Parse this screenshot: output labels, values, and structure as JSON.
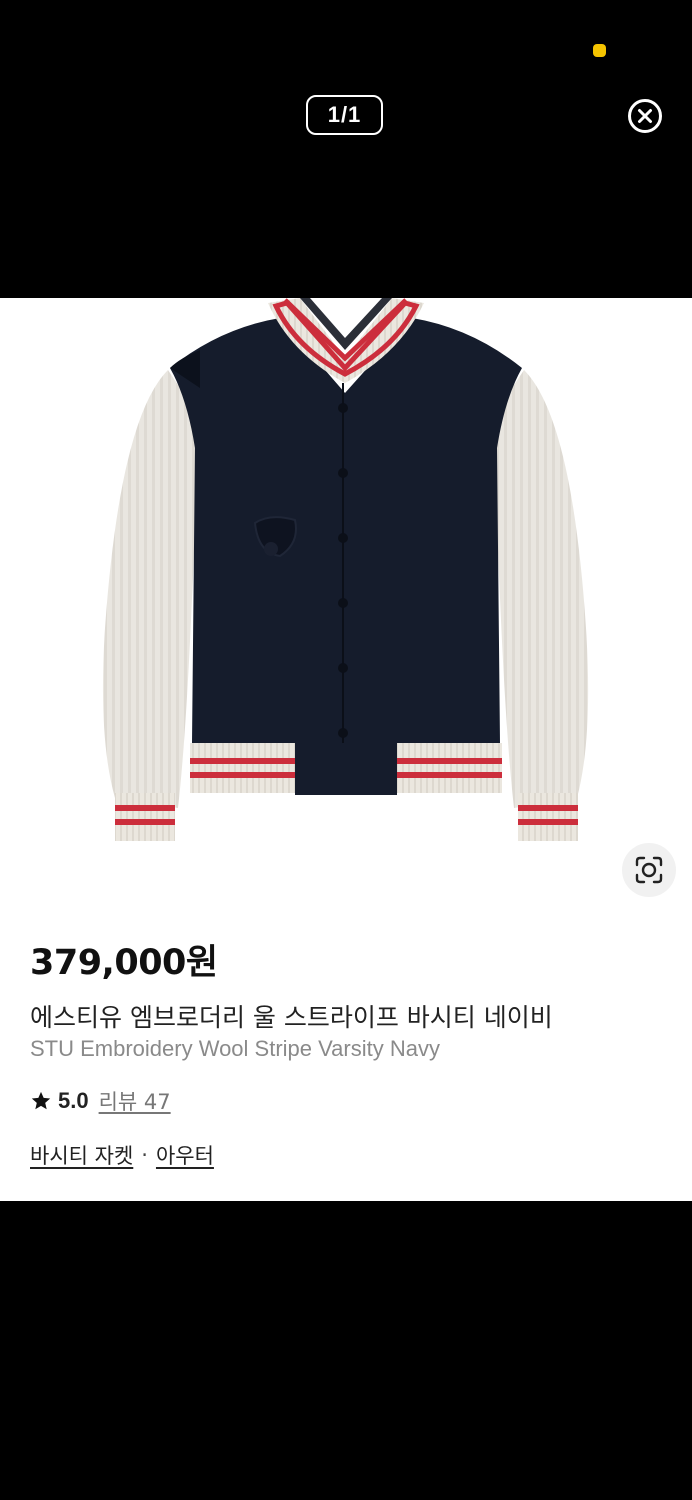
{
  "viewer": {
    "counter": "1/1",
    "close_icon": "close-circle-icon"
  },
  "product": {
    "price": "379,000원",
    "name_ko": "에스티유 엠브로더리 울 스트라이프 바시티 네이비",
    "name_en": "STU Embroidery Wool Stripe Varsity Navy",
    "rating": "5.0",
    "review_label": "리뷰 47",
    "categories": [
      "바시티 자켓",
      "아우터"
    ],
    "category_separator": "·"
  },
  "colors": {
    "navy": "#151c2c",
    "cream": "#ebe7df",
    "stripe_red": "#cc2e3c",
    "status_dot": "#f5c400"
  },
  "icons": {
    "rating": "star-icon",
    "image_search": "lens-search-icon"
  }
}
